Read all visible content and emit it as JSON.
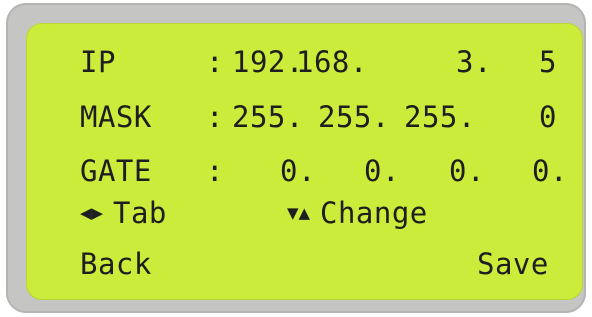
{
  "display": {
    "ip": {
      "label": "IP",
      "separator": ":",
      "octets": [
        "192.",
        "168.",
        "3.",
        "5"
      ]
    },
    "mask": {
      "label": "MASK",
      "separator": ":",
      "octets": [
        "255.",
        "255.",
        "255.",
        "0"
      ]
    },
    "gate": {
      "label": "GATE",
      "separator": ":",
      "octets": [
        "0.",
        "0.",
        "0.",
        "0."
      ]
    },
    "hints": {
      "tab_label": "Tab",
      "change_label": "Change",
      "left_right_icon": "left-right-triangle-icon",
      "down_up_icon": "down-up-triangle-icon"
    },
    "softkeys": {
      "back_label": "Back",
      "save_label": "Save"
    }
  },
  "colors": {
    "lcd_background": "#ccec3c",
    "lcd_text": "#1e1e1e",
    "bezel": "#c5c6c3"
  }
}
